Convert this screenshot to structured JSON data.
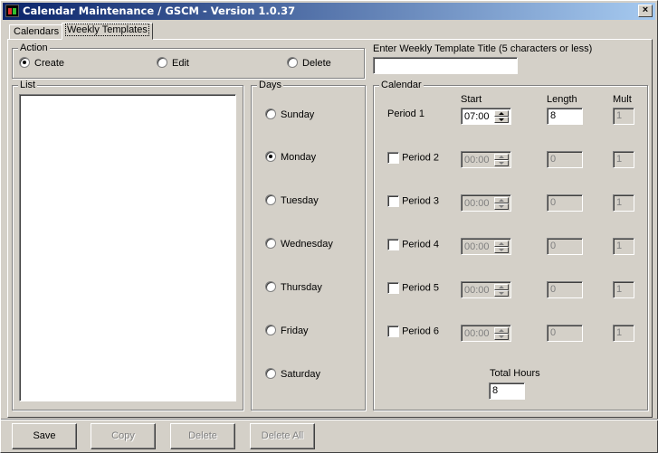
{
  "window": {
    "title": "Calendar Maintenance / GSCM - Version 1.0.37",
    "close_label": "×"
  },
  "tabs": [
    {
      "label": "Calendars"
    },
    {
      "label": "Weekly Templates"
    }
  ],
  "action": {
    "label": "Action",
    "options": [
      {
        "label": "Create",
        "selected": true
      },
      {
        "label": "Edit",
        "selected": false
      },
      {
        "label": "Delete",
        "selected": false
      }
    ]
  },
  "template_title": {
    "label": "Enter Weekly Template Title (5 characters or less)",
    "value": ""
  },
  "list": {
    "label": "List",
    "items": []
  },
  "days": {
    "label": "Days",
    "options": [
      {
        "label": "Sunday",
        "selected": false
      },
      {
        "label": "Monday",
        "selected": true
      },
      {
        "label": "Tuesday",
        "selected": false
      },
      {
        "label": "Wednesday",
        "selected": false
      },
      {
        "label": "Thursday",
        "selected": false
      },
      {
        "label": "Friday",
        "selected": false
      },
      {
        "label": "Saturday",
        "selected": false
      }
    ]
  },
  "calendar": {
    "label": "Calendar",
    "headers": {
      "start": "Start",
      "length": "Length",
      "mult": "Mult"
    },
    "periods": [
      {
        "label": "Period 1",
        "start": "07:00",
        "length": "8",
        "mult": "1",
        "has_checkbox": false,
        "enabled": true
      },
      {
        "label": "Period 2",
        "start": "00:00",
        "length": "0",
        "mult": "1",
        "has_checkbox": true,
        "enabled": false
      },
      {
        "label": "Period 3",
        "start": "00:00",
        "length": "0",
        "mult": "1",
        "has_checkbox": true,
        "enabled": false
      },
      {
        "label": "Period 4",
        "start": "00:00",
        "length": "0",
        "mult": "1",
        "has_checkbox": true,
        "enabled": false
      },
      {
        "label": "Period 5",
        "start": "00:00",
        "length": "0",
        "mult": "1",
        "has_checkbox": true,
        "enabled": false
      },
      {
        "label": "Period 6",
        "start": "00:00",
        "length": "0",
        "mult": "1",
        "has_checkbox": true,
        "enabled": false
      }
    ],
    "total_hours": {
      "label": "Total Hours",
      "value": "8"
    }
  },
  "buttons": [
    {
      "label": "Save",
      "enabled": true
    },
    {
      "label": "Copy",
      "enabled": false
    },
    {
      "label": "Delete",
      "enabled": false
    },
    {
      "label": "Delete All",
      "enabled": false
    }
  ]
}
